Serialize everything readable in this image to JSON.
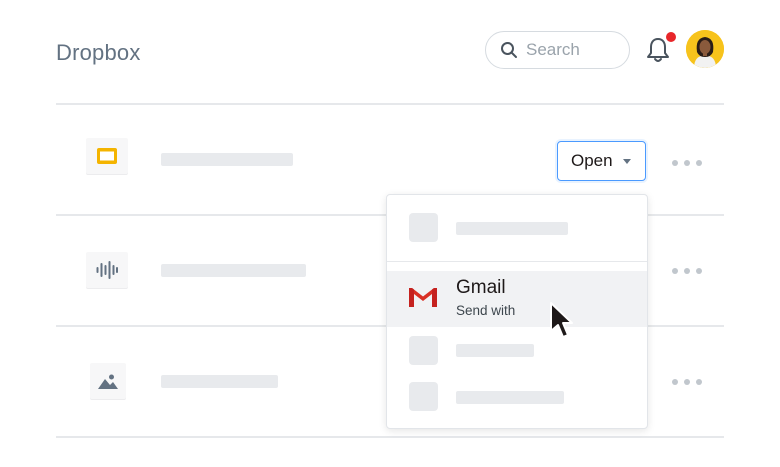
{
  "header": {
    "title": "Dropbox",
    "search_placeholder": "Search",
    "notification_dot_color": "#e8262a"
  },
  "files": [
    {
      "icon": "slides-icon",
      "has_open_button": true
    },
    {
      "icon": "audio-waveform-icon",
      "has_open_button": false
    },
    {
      "icon": "image-icon",
      "has_open_button": false
    }
  ],
  "open_button": {
    "label": "Open"
  },
  "dropdown": {
    "highlighted_item": {
      "label": "Gmail",
      "sublabel": "Send with",
      "icon": "gmail-icon"
    }
  },
  "colors": {
    "accent": "#4b9aff",
    "slides_yellow": "#f4b400",
    "gmail_red": "#d93025"
  }
}
